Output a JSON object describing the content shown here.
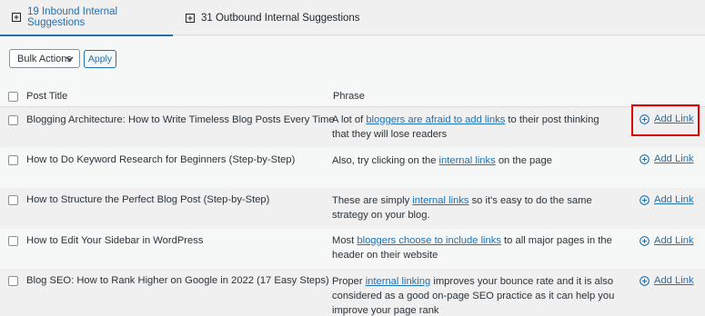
{
  "tabs": [
    {
      "label": "19 Inbound Internal Suggestions",
      "icon": "collapse-square-icon"
    },
    {
      "label": "31 Outbound Internal Suggestions",
      "icon": "expand-square-icon"
    }
  ],
  "toolbar": {
    "bulk_actions": "Bulk Actions",
    "apply": "Apply"
  },
  "table": {
    "col_title": "Post Title",
    "col_phrase": "Phrase",
    "add_link_label": "Add Link",
    "rows": [
      {
        "title": "Blogging Architecture: How to Write Timeless Blog Posts Every Time",
        "phrase_before": "A lot of ",
        "phrase_link": "bloggers are afraid to add links",
        "phrase_after": " to their post thinking that they will lose readers"
      },
      {
        "title": "How to Do Keyword Research for Beginners (Step-by-Step)",
        "phrase_before": "Also, try clicking on the ",
        "phrase_link": "internal links",
        "phrase_after": " on the page"
      },
      {
        "title": "How to Structure the Perfect Blog Post (Step-by-Step)",
        "phrase_before": "These are simply ",
        "phrase_link": "internal links",
        "phrase_after": " so it's easy to do the same strategy on your blog."
      },
      {
        "title": "How to Edit Your Sidebar in WordPress",
        "phrase_before": "Most ",
        "phrase_link": "bloggers choose to include links",
        "phrase_after": " to all major pages in the header on their website"
      },
      {
        "title": "Blog SEO: How to Rank Higher on Google in 2022 (17 Easy Steps)",
        "phrase_before": "Proper ",
        "phrase_link": "internal linking",
        "phrase_after": " improves your bounce rate and it is also considered as a good on-page SEO practice as it can help you improve your page rank"
      }
    ]
  },
  "colors": {
    "accent": "#2271b1",
    "highlight": "#e00000"
  }
}
